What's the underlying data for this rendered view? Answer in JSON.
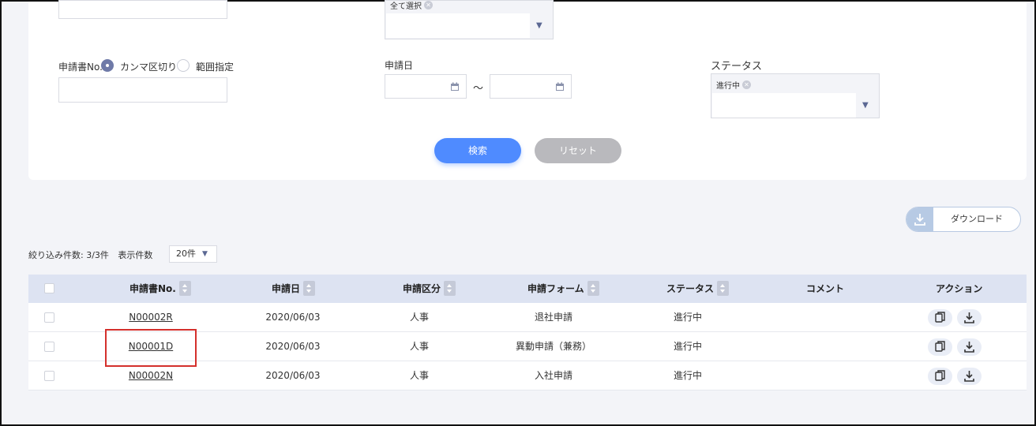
{
  "filters": {
    "top_chip": "全て選択",
    "application_no_label": "申請書No.",
    "radio_comma": "カンマ区切り",
    "radio_range": "範囲指定",
    "date_label": "申請日",
    "date_separator": "〜",
    "status_label": "ステータス",
    "status_chip": "進行中"
  },
  "buttons": {
    "search": "検索",
    "reset": "リセット",
    "download": "ダウンロード"
  },
  "list_info": {
    "filter_count": "絞り込み件数: 3/3件",
    "display_count_label": "表示件数",
    "page_size": "20件"
  },
  "table": {
    "headers": {
      "no": "申請書No.",
      "date": "申請日",
      "category": "申請区分",
      "form": "申請フォーム",
      "status": "ステータス",
      "comment": "コメント",
      "action": "アクション"
    },
    "rows": [
      {
        "no": "N00002R",
        "date": "2020/06/03",
        "category": "人事",
        "form": "退社申請",
        "status": "進行中",
        "comment": ""
      },
      {
        "no": "N00001D",
        "date": "2020/06/03",
        "category": "人事",
        "form": "異動申請（兼務）",
        "status": "進行中",
        "comment": ""
      },
      {
        "no": "N00002N",
        "date": "2020/06/03",
        "category": "人事",
        "form": "入社申請",
        "status": "進行中",
        "comment": ""
      }
    ]
  },
  "icons": [
    "calendar-icon",
    "chevron-down-icon",
    "close-icon",
    "sort-icon",
    "copy-icon",
    "download-icon"
  ],
  "colors": {
    "accent": "#4f8bff",
    "highlight": "#d4302c",
    "header_bg": "#dde3f2"
  }
}
